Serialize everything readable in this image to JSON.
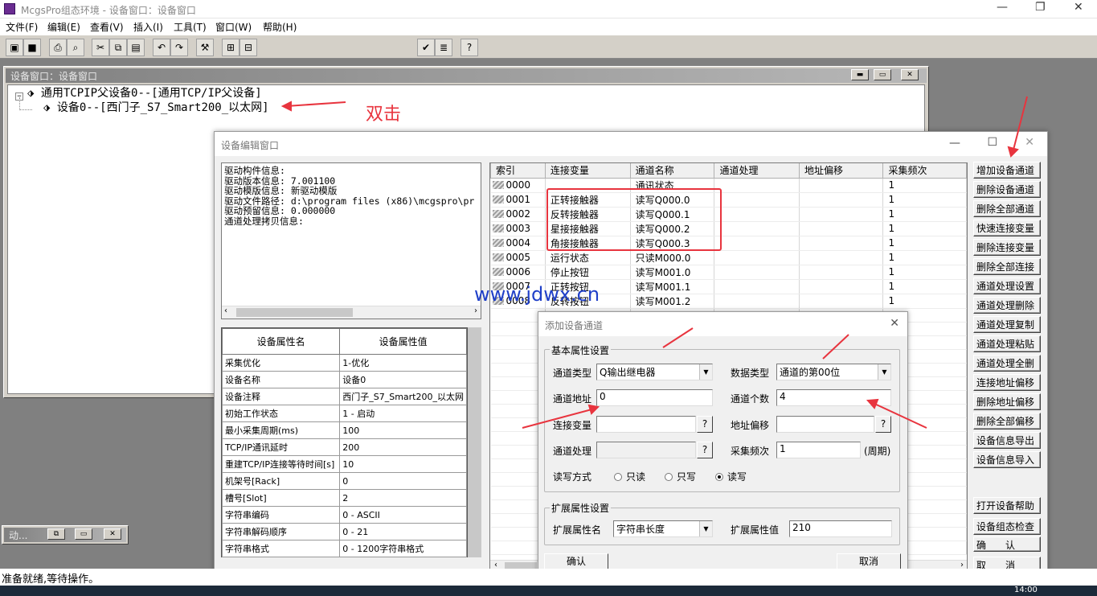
{
  "app": {
    "title": "McgsPro组态环境 - 设备窗口：设备窗口",
    "status": "准备就绪,等待操作。",
    "time": "14:00"
  },
  "menu": [
    "文件(F)",
    "编辑(E)",
    "查看(V)",
    "插入(I)",
    "工具(T)",
    "窗口(W)",
    "帮助(H)"
  ],
  "device_window": {
    "title": "设备窗口：设备窗口",
    "tree": [
      {
        "label": "通用TCPIP父设备0--[通用TCP/IP父设备]"
      },
      {
        "label": "设备0--[西门子_S7_Smart200_以太网]"
      }
    ],
    "annotation": "双击"
  },
  "minimized_window": {
    "title": "动..."
  },
  "editor": {
    "title": "设备编辑窗口",
    "watermark": "www.jdwx.cn",
    "driver_info": [
      "驱动构件信息:",
      "驱动版本信息: 7.001100",
      "驱动模版信息: 新驱动模版",
      "驱动文件路径: d:\\program files (x86)\\mcgspro\\pr",
      "驱动预留信息: 0.000000",
      "通道处理拷贝信息:"
    ],
    "props_headers": [
      "设备属性名",
      "设备属性值"
    ],
    "props": [
      [
        "采集优化",
        "1-优化"
      ],
      [
        "设备名称",
        "设备0"
      ],
      [
        "设备注释",
        "西门子_S7_Smart200_以太网"
      ],
      [
        "初始工作状态",
        "1 - 启动"
      ],
      [
        "最小采集周期(ms)",
        "100"
      ],
      [
        "TCP/IP通讯延时",
        "200"
      ],
      [
        "重建TCP/IP连接等待时间[s]",
        "10"
      ],
      [
        "机架号[Rack]",
        "0"
      ],
      [
        "槽号[Slot]",
        "2"
      ],
      [
        "字符串编码",
        "0 - ASCII"
      ],
      [
        "字符串解码顺序",
        "0 - 21"
      ],
      [
        "字符串格式",
        "0 - 1200字符串格式"
      ]
    ],
    "grid_headers": [
      "索引",
      "连接变量",
      "通道名称",
      "通道处理",
      "地址偏移",
      "采集频次"
    ],
    "grid_rows": [
      [
        "0000",
        "",
        "通讯状态",
        "",
        "",
        "1"
      ],
      [
        "0001",
        "正转接触器",
        "读写Q000.0",
        "",
        "",
        "1"
      ],
      [
        "0002",
        "反转接触器",
        "读写Q000.1",
        "",
        "",
        "1"
      ],
      [
        "0003",
        "星接接触器",
        "读写Q000.2",
        "",
        "",
        "1"
      ],
      [
        "0004",
        "角接接触器",
        "读写Q000.3",
        "",
        "",
        "1"
      ],
      [
        "0005",
        "运行状态",
        "只读M000.0",
        "",
        "",
        "1"
      ],
      [
        "0006",
        "停止按钮",
        "读写M001.0",
        "",
        "",
        "1"
      ],
      [
        "0007",
        "正转按钮",
        "读写M001.1",
        "",
        "",
        "1"
      ],
      [
        "0008",
        "反转按钮",
        "读写M001.2",
        "",
        "",
        "1"
      ]
    ],
    "side_buttons": [
      "增加设备通道",
      "删除设备通道",
      "删除全部通道",
      "快速连接变量",
      "删除连接变量",
      "删除全部连接",
      "通道处理设置",
      "通道处理删除",
      "通道处理复制",
      "通道处理粘贴",
      "通道处理全删",
      "连接地址偏移",
      "删除地址偏移",
      "删除全部偏移",
      "设备信息导出",
      "设备信息导入"
    ],
    "side_buttons_bottom": [
      "打开设备帮助",
      "设备组态检查",
      "确　　认",
      "取　　消"
    ]
  },
  "dialog": {
    "title": "添加设备通道",
    "basic_group": "基本属性设置",
    "channel_type_label": "通道类型",
    "channel_type_value": "Q输出继电器",
    "data_type_label": "数据类型",
    "data_type_value": "通道的第00位",
    "channel_addr_label": "通道地址",
    "channel_addr_value": "0",
    "channel_count_label": "通道个数",
    "channel_count_value": "4",
    "link_var_label": "连接变量",
    "link_var_value": "",
    "addr_offset_label": "地址偏移",
    "addr_offset_value": "",
    "channel_proc_label": "通道处理",
    "channel_proc_value": "",
    "collect_freq_label": "采集频次",
    "collect_freq_value": "1",
    "period_label": "(周期)",
    "rw_label": "读写方式",
    "rw_options": [
      "只读",
      "只写",
      "读写"
    ],
    "rw_selected": 2,
    "ext_group": "扩展属性设置",
    "ext_name_label": "扩展属性名",
    "ext_name_value": "字符串长度",
    "ext_value_label": "扩展属性值",
    "ext_value_value": "210",
    "ok": "确认",
    "cancel": "取消",
    "question": "?"
  },
  "colors": {
    "annotation": "#e8343e",
    "watermark": "#1f3fc8"
  }
}
